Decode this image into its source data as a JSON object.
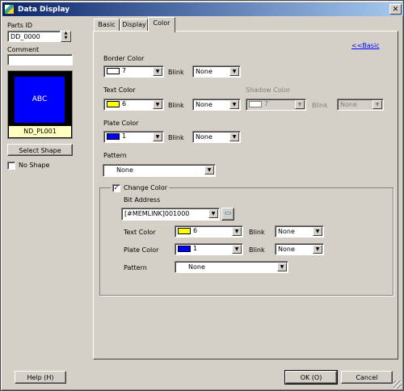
{
  "window": {
    "title": "Data Display",
    "close": "✕"
  },
  "left": {
    "parts_id_label": "Parts ID",
    "parts_id": "DD_0000",
    "comment_label": "Comment",
    "comment": "",
    "preview_text": "ABC",
    "preview_name": "ND_PL001",
    "select_shape": "Select Shape",
    "no_shape": "No Shape"
  },
  "tabs": [
    {
      "label": "Basic"
    },
    {
      "label": "Display"
    },
    {
      "label": "Color"
    }
  ],
  "basic_link": "<<Basic",
  "border": {
    "label": "Border Color",
    "color": "7",
    "blink_label": "Blink",
    "blink": "None",
    "swatch": "#ffffff"
  },
  "text": {
    "label": "Text Color",
    "color": "6",
    "blink_label": "Blink",
    "blink": "None",
    "swatch": "#ffff00"
  },
  "shadow": {
    "label": "Shadow Color",
    "color": "7",
    "blink_label": "Blink",
    "blink": "None"
  },
  "plate": {
    "label": "Plate Color",
    "color": "1",
    "blink_label": "Blink",
    "blink": "None",
    "swatch": "#0000ff"
  },
  "pattern": {
    "label": "Pattern",
    "value": "None"
  },
  "change": {
    "label": "Change Color",
    "checked": "✓",
    "bit_label": "Bit Address",
    "bit": "[#MEMLINK]001000",
    "text_label": "Text Color",
    "text_color": "6",
    "text_blink_label": "Blink",
    "text_blink": "None",
    "plate_label": "Plate Color",
    "plate_color": "1",
    "plate_blink_label": "Blink",
    "plate_blink": "None",
    "pattern_label": "Pattern",
    "pattern": "None"
  },
  "buttons": {
    "help": "Help (H)",
    "ok": "OK (O)",
    "cancel": "Cancel"
  }
}
